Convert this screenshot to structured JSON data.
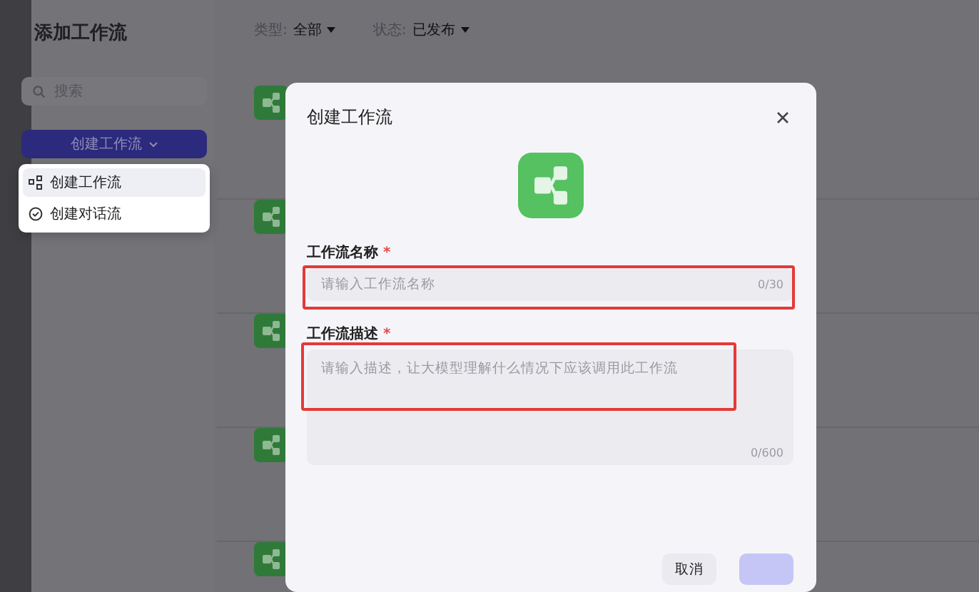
{
  "sidebar": {
    "title": "添加工作流",
    "search": {
      "placeholder": "搜索"
    },
    "create_button": {
      "label": "创建工作流"
    },
    "menu": [
      {
        "label": "创建工作流",
        "kind": "workflow",
        "selected": true
      },
      {
        "label": "创建对话流",
        "kind": "chatflow",
        "selected": false
      }
    ]
  },
  "filters": [
    {
      "label": "类型:",
      "value": "全部"
    },
    {
      "label": "状态:",
      "value": "已发布"
    }
  ],
  "rows": [
    {
      "kind": "workflow"
    },
    {
      "kind": "workflow"
    },
    {
      "kind": "workflow"
    },
    {
      "kind": "workflow"
    },
    {
      "kind": "workflow"
    }
  ],
  "dialog": {
    "title": "创建工作流",
    "fields": [
      {
        "kind": "input",
        "label": "工作流名称",
        "required_mark": "*",
        "placeholder": "请输入工作流名称",
        "counter": "0/30",
        "highlighted": true
      },
      {
        "kind": "textarea",
        "label": "工作流描述",
        "required_mark": "*",
        "placeholder": "请输入描述，让大模型理解什么情况下应该调用此工作流",
        "counter": "0/600",
        "highlighted": true
      }
    ],
    "buttons": [
      {
        "kind": "secondary",
        "label": "取消"
      },
      {
        "kind": "primary"
      }
    ]
  }
}
